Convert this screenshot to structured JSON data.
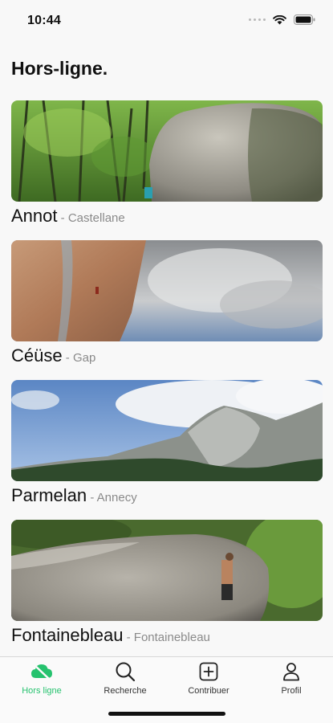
{
  "status": {
    "time": "10:44"
  },
  "page": {
    "title": "Hors-ligne."
  },
  "crags": [
    {
      "name": "Annot",
      "separator": " - ",
      "region": "Castellane"
    },
    {
      "name": "Céüse",
      "separator": " - ",
      "region": "Gap"
    },
    {
      "name": "Parmelan",
      "separator": " - ",
      "region": "Annecy"
    },
    {
      "name": "Fontainebleau",
      "separator": " - ",
      "region": "Fontainebleau"
    }
  ],
  "tabs": [
    {
      "label": "Hors ligne",
      "icon": "offline-cloud-icon",
      "active": true
    },
    {
      "label": "Recherche",
      "icon": "search-icon",
      "active": false
    },
    {
      "label": "Contribuer",
      "icon": "add-square-icon",
      "active": false
    },
    {
      "label": "Profil",
      "icon": "person-icon",
      "active": false
    }
  ],
  "colors": {
    "accent": "#25c26e",
    "inactive": "#333333",
    "secondary_text": "#8a8a8a"
  }
}
